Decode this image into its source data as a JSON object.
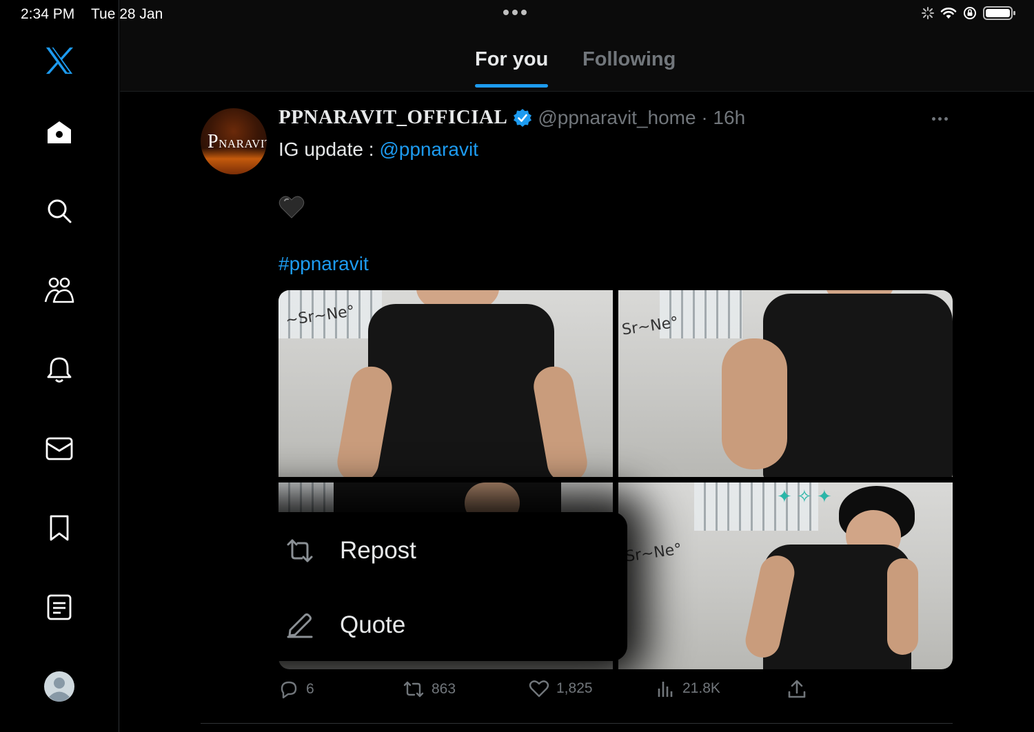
{
  "status_bar": {
    "time": "2:34 PM",
    "date": "Tue 28 Jan"
  },
  "sidebar": {
    "items": [
      {
        "name": "logo",
        "icon": "x-logo-icon"
      },
      {
        "name": "home",
        "icon": "home-icon"
      },
      {
        "name": "search",
        "icon": "search-icon"
      },
      {
        "name": "communities",
        "icon": "communities-icon"
      },
      {
        "name": "notifications",
        "icon": "bell-icon"
      },
      {
        "name": "messages",
        "icon": "mail-icon"
      },
      {
        "name": "bookmarks",
        "icon": "bookmark-icon"
      },
      {
        "name": "lists",
        "icon": "list-icon"
      },
      {
        "name": "profile",
        "icon": "avatar-icon"
      }
    ]
  },
  "tabs": [
    {
      "label": "For you",
      "active": true
    },
    {
      "label": "Following",
      "active": false
    }
  ],
  "tweet": {
    "avatar_text_initial": "P",
    "avatar_text_rest": "NARAVIT",
    "display_name": "PPNARAVIT_OFFICIAL",
    "handle_time": "@ppnaravit_home · 16h",
    "text_prefix": "IG update : ",
    "mention": "@ppnaravit",
    "hashtag": "#ppnaravit",
    "stats": {
      "replies": "6",
      "reposts": "863",
      "likes": "1,825",
      "views": "21.8K"
    }
  },
  "repost_menu": {
    "items": [
      {
        "label": "Repost",
        "icon": "repost-icon"
      },
      {
        "label": "Quote",
        "icon": "quote-pencil-icon"
      }
    ]
  },
  "colors": {
    "accent": "#1d9bf0",
    "muted": "#71767b",
    "text": "#e7e9ea",
    "background": "#000000"
  }
}
